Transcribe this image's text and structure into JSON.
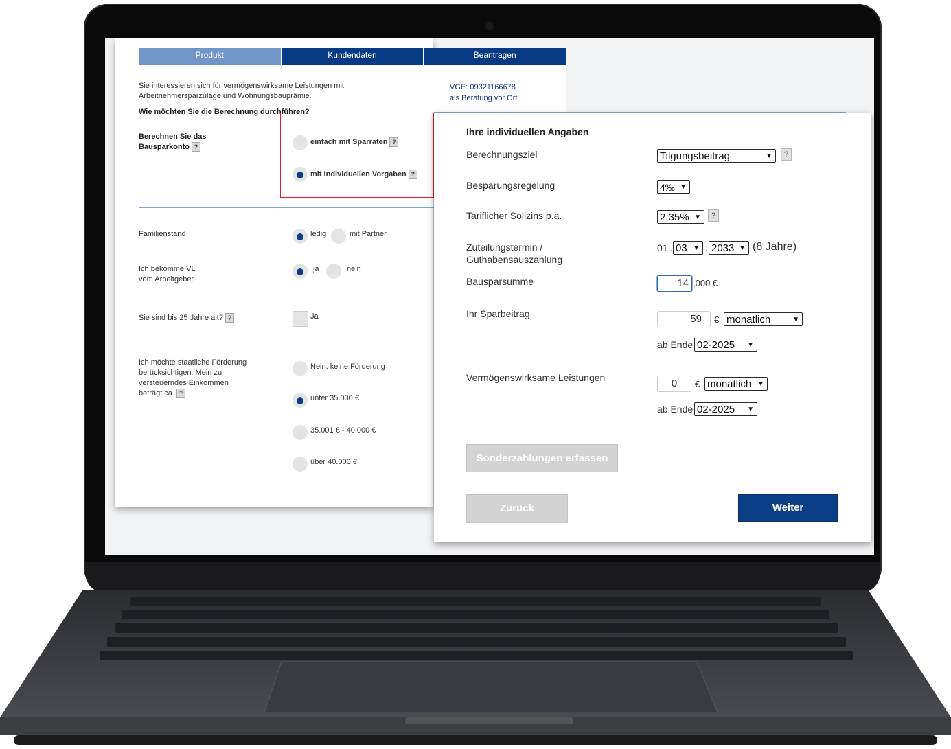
{
  "tabs": [
    "Produkt",
    "Kundendaten",
    "Beantragen"
  ],
  "vge": {
    "line1": "VGE: 09321166678",
    "line2": "als Beratung vor Ort"
  },
  "intro": "Sie interessieren sich für vermögenswirksame Leistungen mit Arbeitnehmersparzulage und Wohnungsbauprämie.",
  "question": "Wie möchten Sie die Berechnung durchführen?",
  "calc": {
    "label_line1": "Berechnen Sie das",
    "label_line2": "Bausparkonto",
    "option1": "einfach mit Sparraten",
    "option2": "mit individuellen Vorgaben",
    "selected": "mit individuellen Vorgaben"
  },
  "familienstand": {
    "label": "Familienstand",
    "opt1": "ledig",
    "opt2": "mit Partner",
    "selected": "ledig"
  },
  "vl": {
    "label_line1": "Ich bekomme VL",
    "label_line2": "vom Arbeitgeber",
    "opt1": "ja",
    "opt2": "nein",
    "selected": "ja"
  },
  "age": {
    "label": "Sie sind bis 25 Jahre alt?",
    "checkbox_label": "Ja",
    "checked": false
  },
  "foerderung": {
    "label_lines": [
      "Ich möchte staatliche Förderung",
      "berücksichtigen. Mein zu",
      "versteuerndes Einkommen",
      "beträgt ca."
    ],
    "options": [
      "Nein, keine Förderung",
      "unter 35.000 €",
      "35.001 € - 40.000 €",
      "über 40.000 €"
    ],
    "selected": "unter 35.000 €"
  },
  "panel": {
    "title": "Ihre individuellen Angaben",
    "berechnungsziel": {
      "label": "Berechnungsziel",
      "value": "Tilgungsbeitrag"
    },
    "besparungsregelung": {
      "label": "Besparungsregelung",
      "value": "4‰"
    },
    "sollzins": {
      "label": "Tariflicher Sollzins p.a.",
      "value": "2,35%"
    },
    "zuteilung": {
      "label_line1": "Zuteilungstermin /",
      "label_line2": "Guthabensauszahlung",
      "day": "01",
      "dot": ".",
      "month": "03",
      "year": "2033",
      "note": "(8 Jahre)"
    },
    "bausparsumme": {
      "label": "Bausparsumme",
      "value": "14",
      "suffix": ",000 €"
    },
    "sparbeitrag": {
      "label": "Ihr Sparbeitrag",
      "value": "59",
      "currency": "€",
      "interval": "monatlich",
      "ab_label": "ab Ende",
      "ab_value": "02-2025"
    },
    "vl": {
      "label": "Vermögenswirksame Leistungen",
      "value": "0",
      "currency": "€",
      "interval": "monatlich",
      "ab_label": "ab Ende",
      "ab_value": "02-2025"
    },
    "help": "?",
    "sonder_button": "Sonderzahlungen erfassen",
    "back_button": "Zurück",
    "next_button": "Weiter"
  },
  "colors": {
    "primary": "#0a3f87",
    "tab_light": "#6f95c9",
    "highlight": "#e02020"
  },
  "icons": {
    "help": "question-mark-icon",
    "dropdown": "chevron-down-icon"
  }
}
